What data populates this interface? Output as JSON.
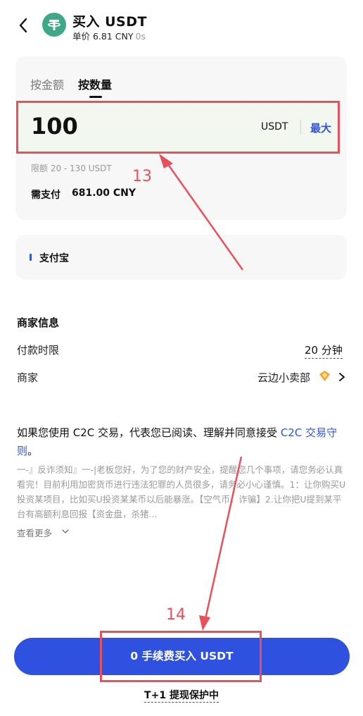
{
  "header": {
    "title": "买入 USDT",
    "price": "单价 6.81 CNY",
    "price_age": "0s",
    "icons": [
      "back-arrow-icon",
      "tether-usdt-icon"
    ],
    "coin_color": "#3ea888"
  },
  "trade": {
    "tabs": [
      {
        "label": "按金额",
        "active": false
      },
      {
        "label": "按数量",
        "active": true
      }
    ],
    "quantity_value": "100",
    "quantity_unit": "USDT",
    "max_label": "最大",
    "limit_text": "限额 20 - 130 USDT",
    "pay_label": "需支付",
    "pay_value": "681.00 CNY"
  },
  "payment": {
    "method": "支付宝",
    "accent_color": "#2f55d8"
  },
  "merchant": {
    "section_title": "商家信息",
    "time_label": "付款时限",
    "time_value": "20  分钟",
    "merchant_label": "商家",
    "merchant_value": "云边小卖部",
    "icons": [
      "merchant-badge-icon",
      "chevron-right-icon"
    ]
  },
  "notice": {
    "text": "如果您使用 C2C 交易，代表您已阅读、理解并同意接受 ",
    "link": "C2C 交易守则",
    "end": "。",
    "fraud_text": "一-』反诈须知』一-|老板您好，为了您的财产安全，提醒您几个事项，请您务必认真看完！目前利用加密货币进行违法犯罪的人员很多，请务必小心谨慎。1：让你购买U投资某项目，比如买U投资某某币以后能暴涨。【空气币，诈骗】2.让你把U提到某平台有高额利息回报【资金盘，杀猪...",
    "more_label": "查看更多"
  },
  "footer": {
    "buy_label": "0 手续费买入 USDT",
    "protection": "T+1 提现保护中",
    "button_color": "#2e52df"
  },
  "annotations": {
    "color": "#e8505b",
    "labels": [
      "13",
      "14"
    ]
  }
}
